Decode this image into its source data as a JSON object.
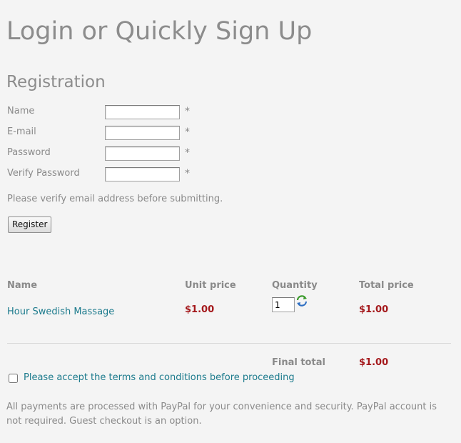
{
  "page_title": "Login or Quickly Sign Up",
  "registration": {
    "title": "Registration",
    "fields": [
      {
        "label": "Name",
        "value": "",
        "required_mark": "*"
      },
      {
        "label": "E-mail",
        "value": "",
        "required_mark": "*"
      },
      {
        "label": "Password",
        "value": "",
        "required_mark": "*"
      },
      {
        "label": "Verify Password",
        "value": "",
        "required_mark": "*"
      }
    ],
    "note": "Please verify email address before submitting.",
    "register_button": "Register"
  },
  "cart": {
    "headers": {
      "name": "Name",
      "unit_price": "Unit price",
      "quantity": "Quantity",
      "total_price": "Total price"
    },
    "items": [
      {
        "name": "Hour Swedish Massage",
        "unit_price": "$1.00",
        "quantity": "1",
        "total_price": "$1.00"
      }
    ],
    "final_total_label": "Final total",
    "final_total": "$1.00",
    "refresh_icon": "refresh-icon"
  },
  "terms": {
    "label": "Please accept the terms and conditions before proceeding",
    "checked": false
  },
  "footer_note": "All payments are processed with PayPal for your convenience and security. PayPal account is not required. Guest checkout is an option.",
  "colors": {
    "background": "#f4f4f4",
    "text": "#8a8a8a",
    "price": "#a4181b",
    "link": "#1b7a8c"
  }
}
